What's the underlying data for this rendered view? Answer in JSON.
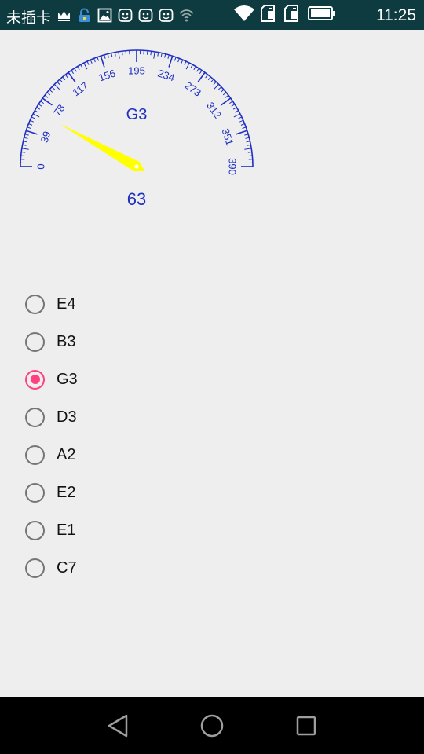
{
  "status_bar": {
    "carrier": "未插卡",
    "time": "11:25",
    "icons_left": [
      "crown-icon",
      "lock-icon",
      "image-icon",
      "cat-icon",
      "cat-icon",
      "cat-icon",
      "wifi-weak-icon"
    ],
    "icons_right": [
      "wifi-icon",
      "sim-icon",
      "sim-icon",
      "battery-icon"
    ]
  },
  "gauge": {
    "min": 0,
    "max": 390,
    "tick_labels": [
      "0",
      "39",
      "78",
      "117",
      "156",
      "195",
      "234",
      "273",
      "312",
      "351",
      "390"
    ],
    "note_label": "G3",
    "value_label": "63",
    "needle_value": 63,
    "color_scale": "#1f2fc2",
    "color_needle": "#ffff00"
  },
  "options": [
    {
      "label": "E4",
      "checked": false
    },
    {
      "label": "B3",
      "checked": false
    },
    {
      "label": "G3",
      "checked": true
    },
    {
      "label": "D3",
      "checked": false
    },
    {
      "label": "A2",
      "checked": false
    },
    {
      "label": "E2",
      "checked": false
    },
    {
      "label": "E1",
      "checked": false
    },
    {
      "label": "C7",
      "checked": false
    }
  ],
  "nav_bar": {
    "buttons": [
      "back-icon",
      "home-icon",
      "recents-icon"
    ]
  }
}
